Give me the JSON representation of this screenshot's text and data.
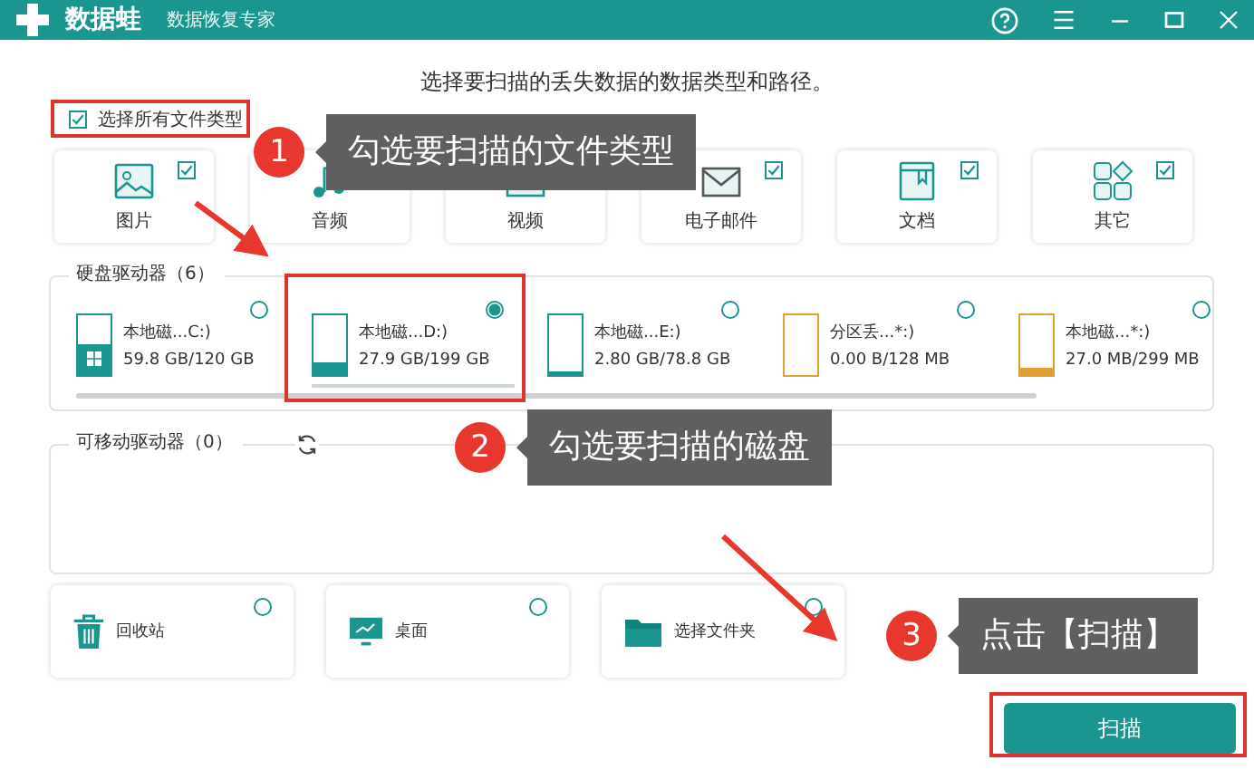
{
  "window": {
    "app_name": "数据蛙",
    "subtitle": "数据恢复专家"
  },
  "heading": "选择要扫描的丢失数据的数据类型和路径。",
  "select_all": {
    "label": "选择所有文件类型",
    "checked": true
  },
  "file_types": [
    {
      "label": "图片",
      "kind": "image",
      "checked": true
    },
    {
      "label": "音频",
      "kind": "audio"
    },
    {
      "label": "视频",
      "kind": "video"
    },
    {
      "label": "电子邮件",
      "kind": "mail",
      "checked": true
    },
    {
      "label": "文档",
      "kind": "document",
      "checked": true
    },
    {
      "label": "其它",
      "kind": "other",
      "checked": true
    }
  ],
  "hard_drives": {
    "title": "硬盘驱动器（6）",
    "drives": [
      {
        "name": "本地磁...C:)",
        "size": "59.8 GB/120 GB",
        "kind": "system",
        "color": "#1b9590",
        "level": 0.5,
        "selected": false
      },
      {
        "name": "本地磁...D:)",
        "size": "27.9 GB/199 GB",
        "kind": "disk",
        "color": "#1b9590",
        "level": 0.2,
        "selected": true
      },
      {
        "name": "本地磁...E:)",
        "size": "2.80 GB/78.8 GB",
        "kind": "disk",
        "color": "#1b9590",
        "level": 0.06,
        "selected": false
      },
      {
        "name": "分区丢...*:)",
        "size": "0.00  B/128 MB",
        "kind": "disk",
        "color": "#e0a030",
        "level": 0,
        "selected": false
      },
      {
        "name": "本地磁...*:)",
        "size": "27.0 MB/299 MB",
        "kind": "disk",
        "color": "#e0a030",
        "level": 0.1,
        "selected": false
      }
    ]
  },
  "removable_drives": {
    "title": "可移动驱动器（0）"
  },
  "locations": [
    {
      "label": "回收站",
      "kind": "trash",
      "selected": false
    },
    {
      "label": "桌面",
      "kind": "desktop",
      "selected": false
    },
    {
      "label": "选择文件夹",
      "kind": "folder",
      "selected": false
    }
  ],
  "scan_button": "扫描",
  "annotations": [
    {
      "number": "1",
      "text": "勾选要扫描的文件类型"
    },
    {
      "number": "2",
      "text": "勾选要扫描的磁盘"
    },
    {
      "number": "3",
      "text": "点击【扫描】"
    }
  ]
}
